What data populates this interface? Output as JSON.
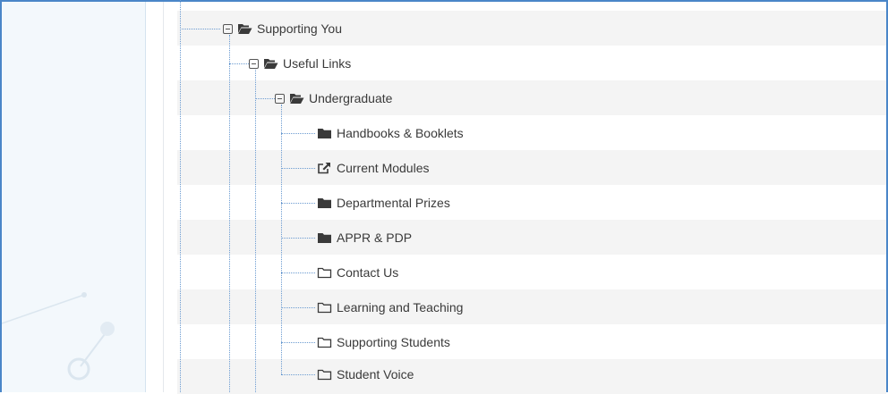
{
  "tree": {
    "items": [
      {
        "label": "Supporting You",
        "icon": "folder-open-icon",
        "expanded": true
      },
      {
        "label": "Useful Links",
        "icon": "folder-open-icon",
        "expanded": true
      },
      {
        "label": "Undergraduate",
        "icon": "folder-open-icon",
        "expanded": true
      },
      {
        "label": "Handbooks & Booklets",
        "icon": "folder-filled-icon"
      },
      {
        "label": "Current Modules",
        "icon": "external-link-icon"
      },
      {
        "label": "Departmental Prizes",
        "icon": "folder-filled-icon"
      },
      {
        "label": "APPR & PDP",
        "icon": "folder-filled-icon"
      },
      {
        "label": "Contact Us",
        "icon": "folder-outline-icon"
      },
      {
        "label": "Learning and Teaching",
        "icon": "folder-outline-icon"
      },
      {
        "label": "Supporting Students",
        "icon": "folder-outline-icon"
      },
      {
        "label": "Student Voice",
        "icon": "folder-outline-icon"
      }
    ]
  },
  "colors": {
    "frame": "#4a86c8",
    "connector": "#6b9bd1",
    "row_shade": "#f4f4f4",
    "left_panel": "#f3f8fc"
  }
}
